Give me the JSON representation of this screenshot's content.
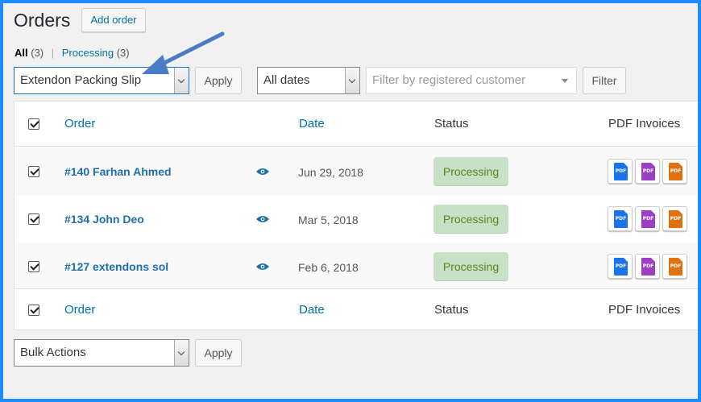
{
  "header": {
    "title": "Orders",
    "add_order_label": "Add order"
  },
  "views": [
    {
      "label": "All",
      "count": "(3)"
    },
    {
      "separator": "|"
    },
    {
      "label": "Processing",
      "count": "(3)"
    }
  ],
  "toolbar_top": {
    "bulk_action_selected": "Extendon Packing Slip",
    "apply_label": "Apply",
    "date_selected": "All dates",
    "customer_placeholder": "Filter by registered customer",
    "filter_label": "Filter"
  },
  "table": {
    "columns": {
      "order": "Order",
      "date": "Date",
      "status": "Status",
      "pdf": "PDF Invoices"
    },
    "rows": [
      {
        "order": "#140 Farhan Ahmed",
        "date": "Jun 29, 2018",
        "status": "Processing"
      },
      {
        "order": "#134 John Deo",
        "date": "Mar 5, 2018",
        "status": "Processing"
      },
      {
        "order": "#127 extendons sol",
        "date": "Feb 6, 2018",
        "status": "Processing"
      }
    ],
    "pdf_icons": [
      {
        "label": "PDF",
        "icon": "pdf-invoice-icon",
        "color": "#1a73e8"
      },
      {
        "label": "PDF",
        "icon": "pdf-packing-slip-icon",
        "color": "#9b3fc4"
      },
      {
        "label": "PDF",
        "icon": "pdf-delivery-note-icon",
        "color": "#e0710f"
      }
    ]
  },
  "toolbar_bottom": {
    "bulk_action_selected": "Bulk Actions",
    "apply_label": "Apply"
  },
  "colors": {
    "frame": "#1e8cff",
    "link": "#0073aa",
    "status_bg": "#c6e1c6",
    "status_text": "#5b841b",
    "arrow": "#4a7dc8"
  }
}
